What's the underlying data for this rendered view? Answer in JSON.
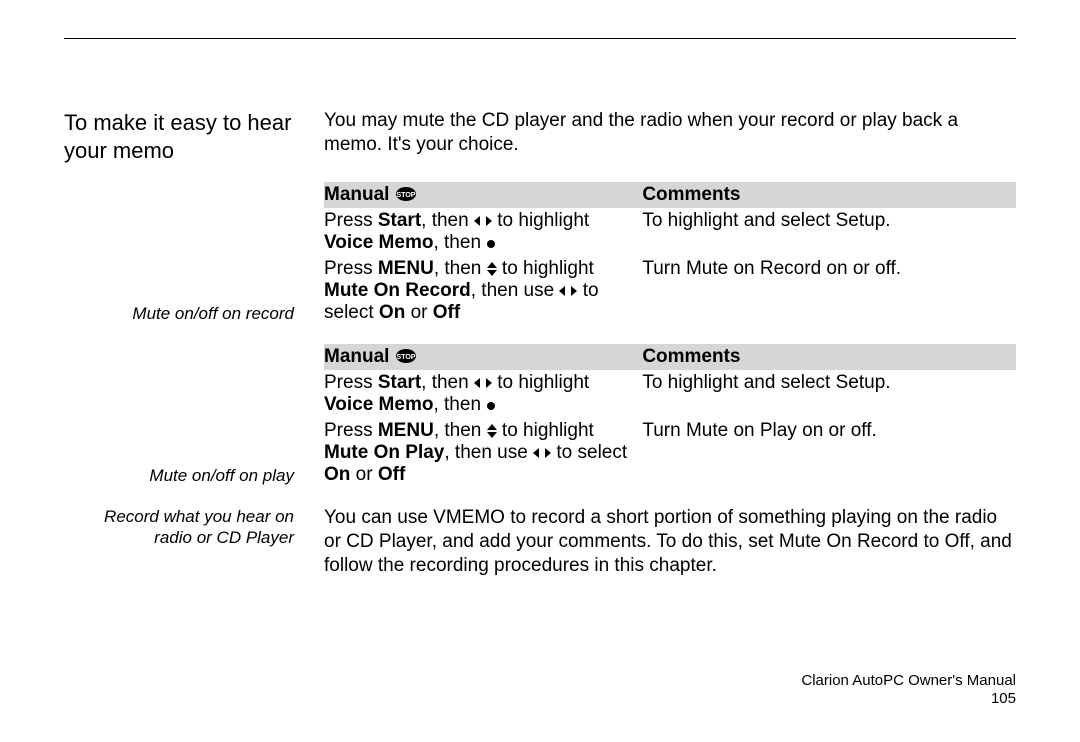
{
  "heading": "To make it easy to hear your memo",
  "intro": "You may mute the CD player and the radio when your record or play back a memo.  It's your choice.",
  "table_headers": {
    "manual": "Manual",
    "comments": "Comments"
  },
  "section1": {
    "side": "Mute on/off on record",
    "rows": [
      {
        "manual_parts": {
          "a": "Press ",
          "b": "Start",
          "c": ", then ",
          "d": " to highlight ",
          "e": "Voice Memo",
          "f": ", then "
        },
        "comment": "To highlight and select Setup."
      },
      {
        "manual_parts": {
          "a": "Press ",
          "b": "MENU",
          "c": ", then ",
          "d": " to highlight ",
          "e": "Mute On Record",
          "f": ", then use ",
          "g": " to select ",
          "h": "On",
          "i": " or ",
          "j": "Off"
        },
        "comment": "Turn Mute on Record on or off."
      }
    ]
  },
  "section2": {
    "side": "Mute on/off on play",
    "rows": [
      {
        "manual_parts": {
          "a": "Press ",
          "b": "Start",
          "c": ", then ",
          "d": " to highlight ",
          "e": "Voice Memo",
          "f": ", then "
        },
        "comment": "To highlight and select Setup."
      },
      {
        "manual_parts": {
          "a": "Press ",
          "b": "MENU",
          "c": ", then ",
          "d": " to highlight ",
          "e": "Mute On Play",
          "f": ", then use ",
          "g": " to select ",
          "h": "On",
          "i": " or ",
          "j": "Off"
        },
        "comment": "Turn Mute on Play on or off."
      }
    ]
  },
  "section3": {
    "side": "Record what you hear on radio or CD Player",
    "body": "You can use VMEMO to record a short portion of something playing on the radio or CD Player, and add your comments.  To do this, set Mute On Record to Off, and follow the recording procedures in this chapter."
  },
  "footer": {
    "line1": "Clarion AutoPC Owner's Manual",
    "line2": "105"
  }
}
